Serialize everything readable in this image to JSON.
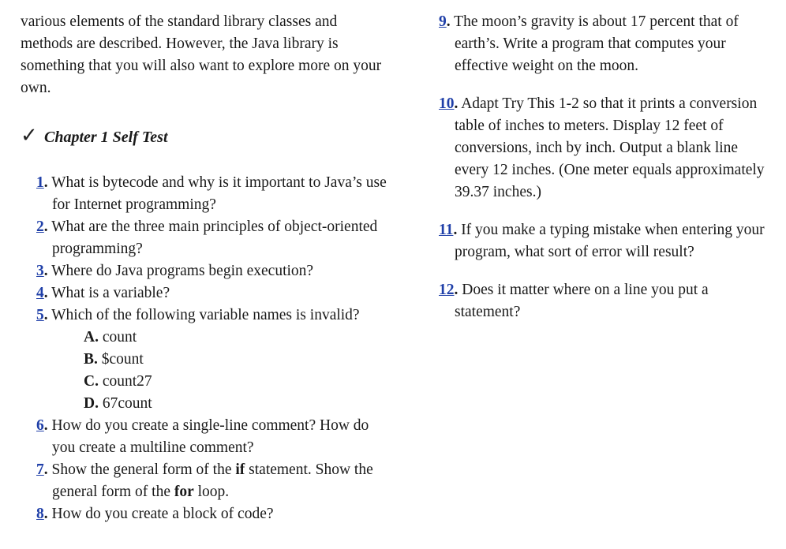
{
  "intro": "various elements of the standard library classes and methods are described. However, the Java library is something that you will also want to explore more on your own.",
  "self_test": {
    "check_icon": "✓",
    "title": "Chapter 1 Self Test"
  },
  "questions": {
    "q1": {
      "num": "1",
      "text": "What is bytecode and why is it important to Java’s use for Internet programming?"
    },
    "q2": {
      "num": "2",
      "text": "What are the three main principles of object-oriented programming?"
    },
    "q3": {
      "num": "3",
      "text": "Where do Java programs begin execution?"
    },
    "q4": {
      "num": "4",
      "text": "What is a variable?"
    },
    "q5": {
      "num": "5",
      "text": "Which of the following variable names is invalid?",
      "choices": [
        {
          "letter": "A.",
          "text": "count"
        },
        {
          "letter": "B.",
          "text": "$count"
        },
        {
          "letter": "C.",
          "text": "count27"
        },
        {
          "letter": "D.",
          "text": "67count"
        }
      ]
    },
    "q6": {
      "num": "6",
      "text": "How do you create a single-line comment? How do you create a multiline comment?"
    },
    "q7": {
      "num": "7",
      "part1": "Show the general form of the ",
      "kw1": "if",
      "part2": " statement. Show the general form of the ",
      "kw2": "for",
      "part3": " loop."
    },
    "q8": {
      "num": "8",
      "text": "How do you create a block of code?"
    },
    "q9": {
      "num": "9",
      "text": "The moon’s gravity is about 17 percent that of earth’s. Write a program that computes your effective weight on the moon."
    },
    "q10": {
      "num": "10",
      "text": "Adapt Try This 1-2 so that it prints a conversion table of inches to meters. Display 12 feet of conversions, inch by inch. Output a blank line every 12 inches. (One meter equals approximately 39.37 inches.)"
    },
    "q11": {
      "num": "11",
      "text": "If you make a typing mistake when entering your program, what sort of error will result?"
    },
    "q12": {
      "num": "12",
      "text": "Does it matter where on a line you put a statement?"
    }
  },
  "colors": {
    "link": "#1f3fa8",
    "text": "#1a1a1a"
  }
}
